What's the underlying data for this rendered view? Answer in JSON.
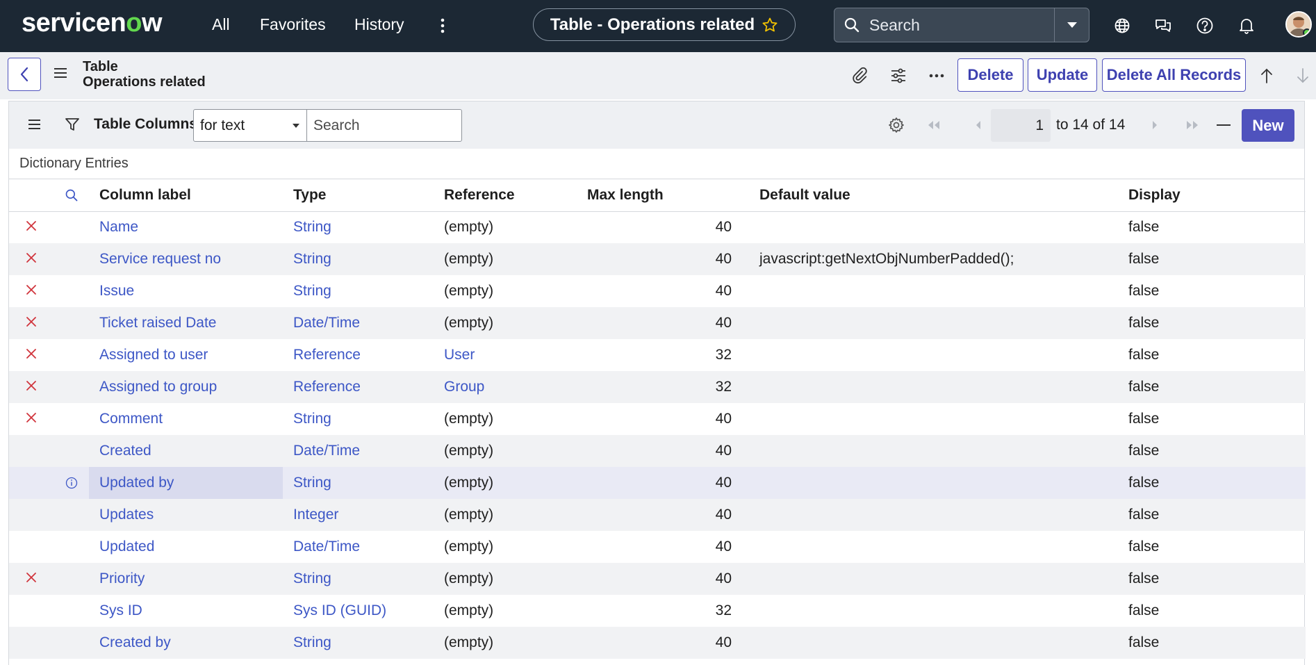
{
  "topnav": {
    "logo": {
      "pre": "servicen",
      "o": "o",
      "post": "w"
    },
    "items": [
      "All",
      "Favorites",
      "History"
    ],
    "context_title": "Table - Operations related",
    "search_placeholder": "Search",
    "colors": {
      "bg": "#1c2834",
      "logo_accent": "#62d84e"
    }
  },
  "record_header": {
    "line1": "Table",
    "line2": "Operations related",
    "buttons": {
      "delete": "Delete",
      "update": "Update",
      "delete_all": "Delete All Records"
    }
  },
  "related_list": {
    "title": "Table Columns",
    "filter_select": "for text",
    "search_placeholder": "Search",
    "page_current": "1",
    "page_range": "to 14 of 14",
    "new_label": "New",
    "breadcrumb": "Dictionary Entries",
    "accent": "#4f52bd",
    "headers": {
      "label": "Column label",
      "type": "Type",
      "reference": "Reference",
      "max_length": "Max length",
      "default": "Default value",
      "display": "Display"
    },
    "rows": [
      {
        "delete": true,
        "label": "Name",
        "type": "String",
        "reference": "(empty)",
        "ref_link": false,
        "max": "40",
        "default": "",
        "display": "false"
      },
      {
        "delete": true,
        "label": "Service request no",
        "type": "String",
        "reference": "(empty)",
        "ref_link": false,
        "max": "40",
        "default": "javascript:getNextObjNumberPadded();",
        "display": "false"
      },
      {
        "delete": true,
        "label": "Issue",
        "type": "String",
        "reference": "(empty)",
        "ref_link": false,
        "max": "40",
        "default": "",
        "display": "false"
      },
      {
        "delete": true,
        "label": "Ticket raised Date",
        "type": "Date/Time",
        "reference": "(empty)",
        "ref_link": false,
        "max": "40",
        "default": "",
        "display": "false"
      },
      {
        "delete": true,
        "label": "Assigned to user",
        "type": "Reference",
        "reference": "User",
        "ref_link": true,
        "max": "32",
        "default": "",
        "display": "false"
      },
      {
        "delete": true,
        "label": "Assigned to group",
        "type": "Reference",
        "reference": "Group",
        "ref_link": true,
        "max": "32",
        "default": "",
        "display": "false"
      },
      {
        "delete": true,
        "label": "Comment",
        "type": "String",
        "reference": "(empty)",
        "ref_link": false,
        "max": "40",
        "default": "",
        "display": "false"
      },
      {
        "delete": false,
        "label": "Created",
        "type": "Date/Time",
        "reference": "(empty)",
        "ref_link": false,
        "max": "40",
        "default": "",
        "display": "false"
      },
      {
        "delete": false,
        "info": true,
        "highlight": true,
        "label": "Updated by",
        "type": "String",
        "reference": "(empty)",
        "ref_link": false,
        "max": "40",
        "default": "",
        "display": "false"
      },
      {
        "delete": false,
        "label": "Updates",
        "type": "Integer",
        "reference": "(empty)",
        "ref_link": false,
        "max": "40",
        "default": "",
        "display": "false"
      },
      {
        "delete": false,
        "label": "Updated",
        "type": "Date/Time",
        "reference": "(empty)",
        "ref_link": false,
        "max": "40",
        "default": "",
        "display": "false"
      },
      {
        "delete": true,
        "label": "Priority",
        "type": "String",
        "reference": "(empty)",
        "ref_link": false,
        "max": "40",
        "default": "",
        "display": "false"
      },
      {
        "delete": false,
        "label": "Sys ID",
        "type": "Sys ID (GUID)",
        "reference": "(empty)",
        "ref_link": false,
        "max": "32",
        "default": "",
        "display": "false"
      },
      {
        "delete": false,
        "label": "Created by",
        "type": "String",
        "reference": "(empty)",
        "ref_link": false,
        "max": "40",
        "default": "",
        "display": "false"
      }
    ]
  }
}
